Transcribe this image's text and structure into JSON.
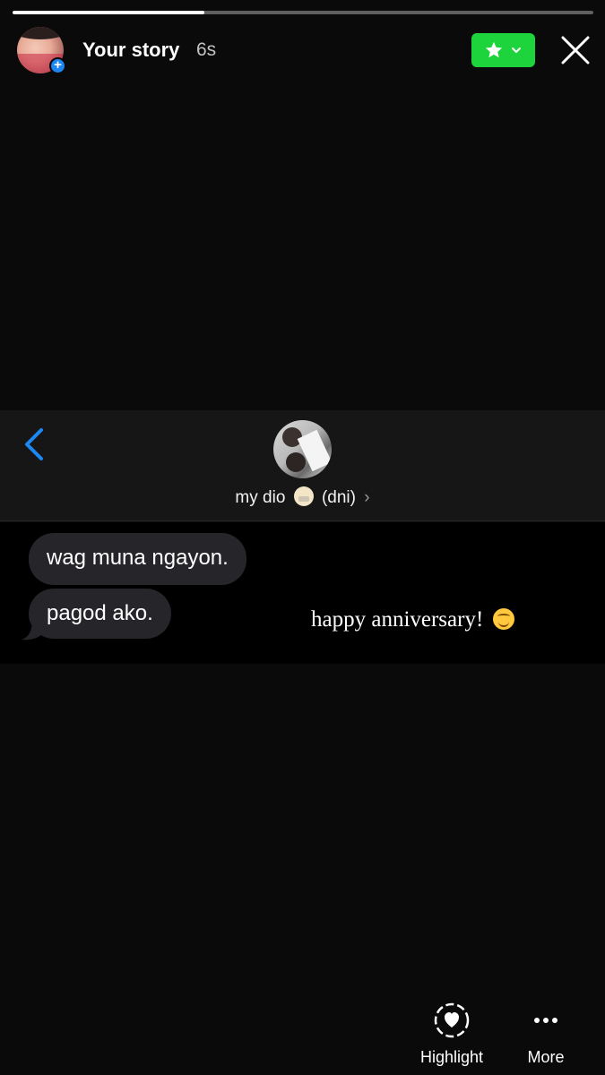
{
  "progress": {
    "fraction": 0.33
  },
  "header": {
    "title": "Your story",
    "time": "6s",
    "audience_icon": "star-icon",
    "close_icon": "close-icon"
  },
  "chat": {
    "contact_name": "my dio",
    "contact_suffix": "(dni)",
    "contact_emoji": "shushing-face-emoji",
    "messages": [
      {
        "text": "wag muna ngayon."
      },
      {
        "text": "pagod ako."
      }
    ],
    "caption": "happy anniversary!",
    "caption_emoji": "smiling-face-emoji"
  },
  "actions": {
    "highlight_label": "Highlight",
    "more_label": "More"
  },
  "colors": {
    "background": "#0a0a0a",
    "accent_green": "#1ed43c",
    "ios_blue": "#1e86f2",
    "bubble_gray": "#26252a"
  }
}
